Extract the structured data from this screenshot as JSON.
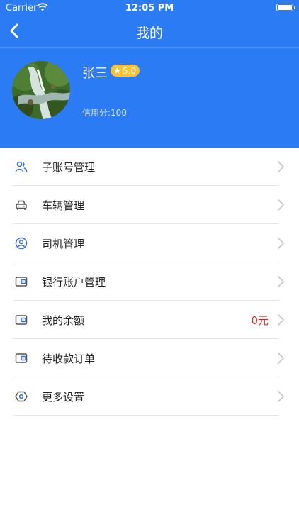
{
  "status_bar": {
    "carrier": "Carrier",
    "time": "12:05 PM"
  },
  "nav": {
    "title": "我的"
  },
  "profile": {
    "name": "张三",
    "rating": "5.0",
    "credit": "信用分:100"
  },
  "menu": [
    {
      "label": "子账号管理",
      "icon": "users-icon",
      "value": ""
    },
    {
      "label": "车辆管理",
      "icon": "car-icon",
      "value": ""
    },
    {
      "label": "司机管理",
      "icon": "driver-icon",
      "value": ""
    },
    {
      "label": "银行账户管理",
      "icon": "wallet-icon",
      "value": ""
    },
    {
      "label": "我的余额",
      "icon": "wallet-icon",
      "value": "0元"
    },
    {
      "label": "待收款订单",
      "icon": "wallet-icon",
      "value": ""
    },
    {
      "label": "更多设置",
      "icon": "settings-icon",
      "value": ""
    }
  ],
  "colors": {
    "header": "#2B7BF5",
    "accent_icon": "#3A6FD8",
    "badge": "#F8C235",
    "value": "#E02020"
  }
}
